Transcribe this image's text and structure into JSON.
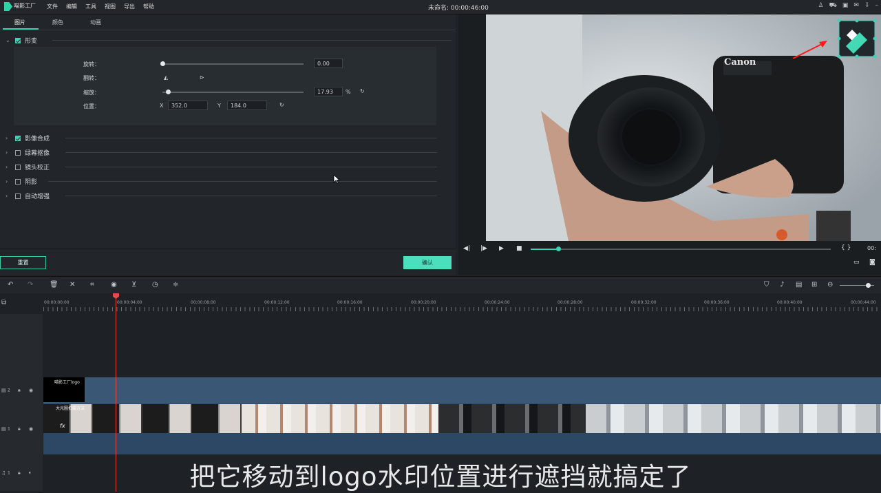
{
  "app": {
    "brand": "喵影工厂",
    "window_title": "未命名: 00:00:46:00"
  },
  "menu": [
    "文件",
    "编辑",
    "工具",
    "视图",
    "导出",
    "帮助"
  ],
  "tabs": [
    "图片",
    "颜色",
    "动画"
  ],
  "sections": {
    "transform": {
      "label": "形变",
      "checked": true
    },
    "others": [
      {
        "label": "影像合成",
        "checked": true
      },
      {
        "label": "绿幕抠像",
        "checked": false
      },
      {
        "label": "镜头校正",
        "checked": false
      },
      {
        "label": "阴影",
        "checked": false
      },
      {
        "label": "自动增强",
        "checked": false
      }
    ]
  },
  "transform": {
    "rotate_label": "旋转：",
    "rotate_value": "0.00",
    "flip_label": "翻转：",
    "scale_label": "缩放：",
    "scale_value": "17.93",
    "scale_unit": "%",
    "position_label": "位置：",
    "x_label": "X",
    "x_value": "352.0",
    "y_label": "Y",
    "y_value": "184.0"
  },
  "buttons": {
    "reset": "重置",
    "ok": "确认"
  },
  "preview": {
    "camera_brand": "Canon",
    "timecode": "00:"
  },
  "timeline": {
    "ruler": [
      "00:00:00:00",
      "00:00:04:00",
      "00:00:08:00",
      "00:00:12:00",
      "00:00:16:00",
      "00:00:20:00",
      "00:00:24:00",
      "00:00:28:00",
      "00:00:32:00",
      "00:00:36:00",
      "00:00:40:00",
      "00:00:44:00"
    ],
    "track2_num": "2",
    "track1_num": "1",
    "audio_num": "1",
    "logo_clip_label": "喵影工厂logo",
    "video_clip_label": "大光圈拍摄方法"
  },
  "subtitle": "把它移动到logo水印位置进行遮挡就搞定了",
  "colors": {
    "accent": "#3fd1b5",
    "playhead": "#e24c4c",
    "clip": "#3b5776"
  }
}
